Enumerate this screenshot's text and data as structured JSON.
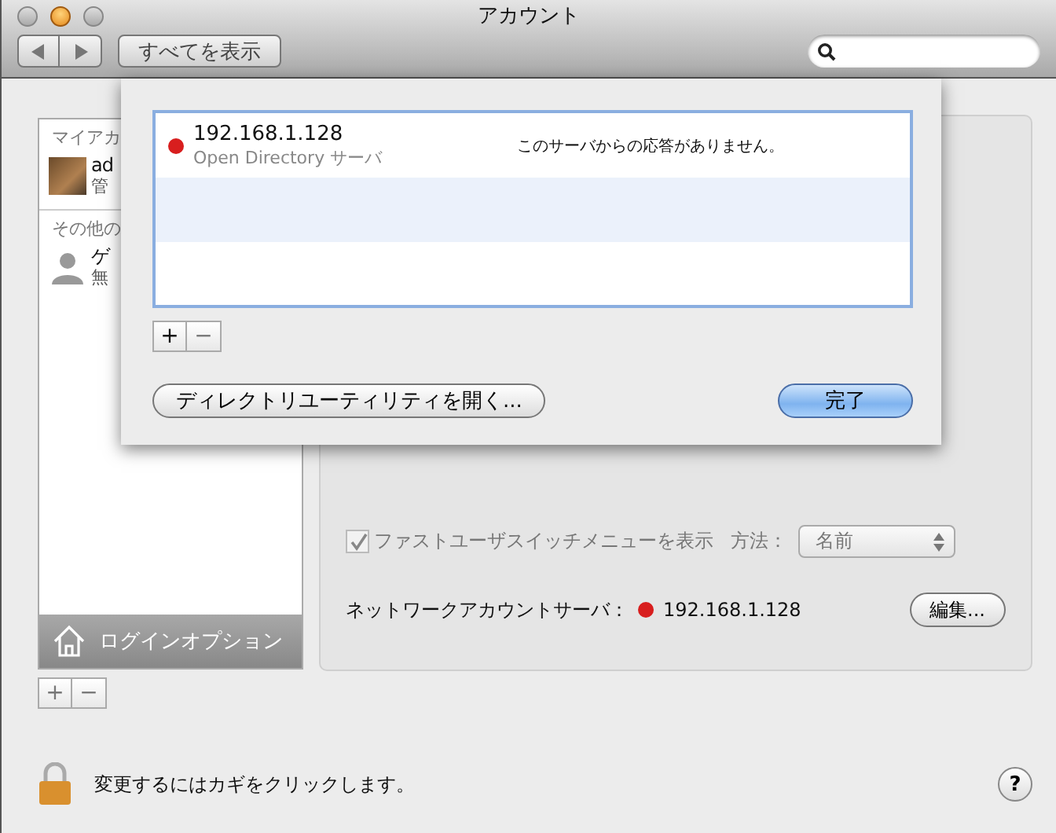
{
  "window": {
    "title": "アカウント"
  },
  "toolbar": {
    "show_all_button": "すべてを表示"
  },
  "sidebar": {
    "sections": [
      {
        "header": "マイアカ",
        "accounts": [
          {
            "name": "ad",
            "role": "管",
            "kind": "photo"
          }
        ]
      },
      {
        "header": "その他の",
        "accounts": [
          {
            "name": "ゲ",
            "role": "無",
            "kind": "silhouette"
          }
        ]
      }
    ],
    "login_options": "ログインオプション",
    "add_button": "+",
    "remove_button": "−"
  },
  "login_panel": {
    "fast_user_switch": {
      "label": "ファストユーザスイッチメニューを表示",
      "checked": true,
      "disabled": true
    },
    "method_label": "方法：",
    "method_value": "名前",
    "network_server_label": "ネットワークアカウントサーバ：",
    "network_server": {
      "address": "192.168.1.128",
      "color": "#d81e1e"
    },
    "edit_button": "編集..."
  },
  "lock": {
    "text": "変更するにはカギをクリックします。"
  },
  "help_button": "?",
  "sheet": {
    "servers": [
      {
        "address": "192.168.1.128",
        "type": "Open Directory サーバ",
        "status": "このサーバからの応答がありません。",
        "color": "#d81e1e",
        "selected": false
      }
    ],
    "add_button": "+",
    "remove_button": "−",
    "open_button": "ディレクトリユーティリティを開く...",
    "done_button": "完了"
  }
}
